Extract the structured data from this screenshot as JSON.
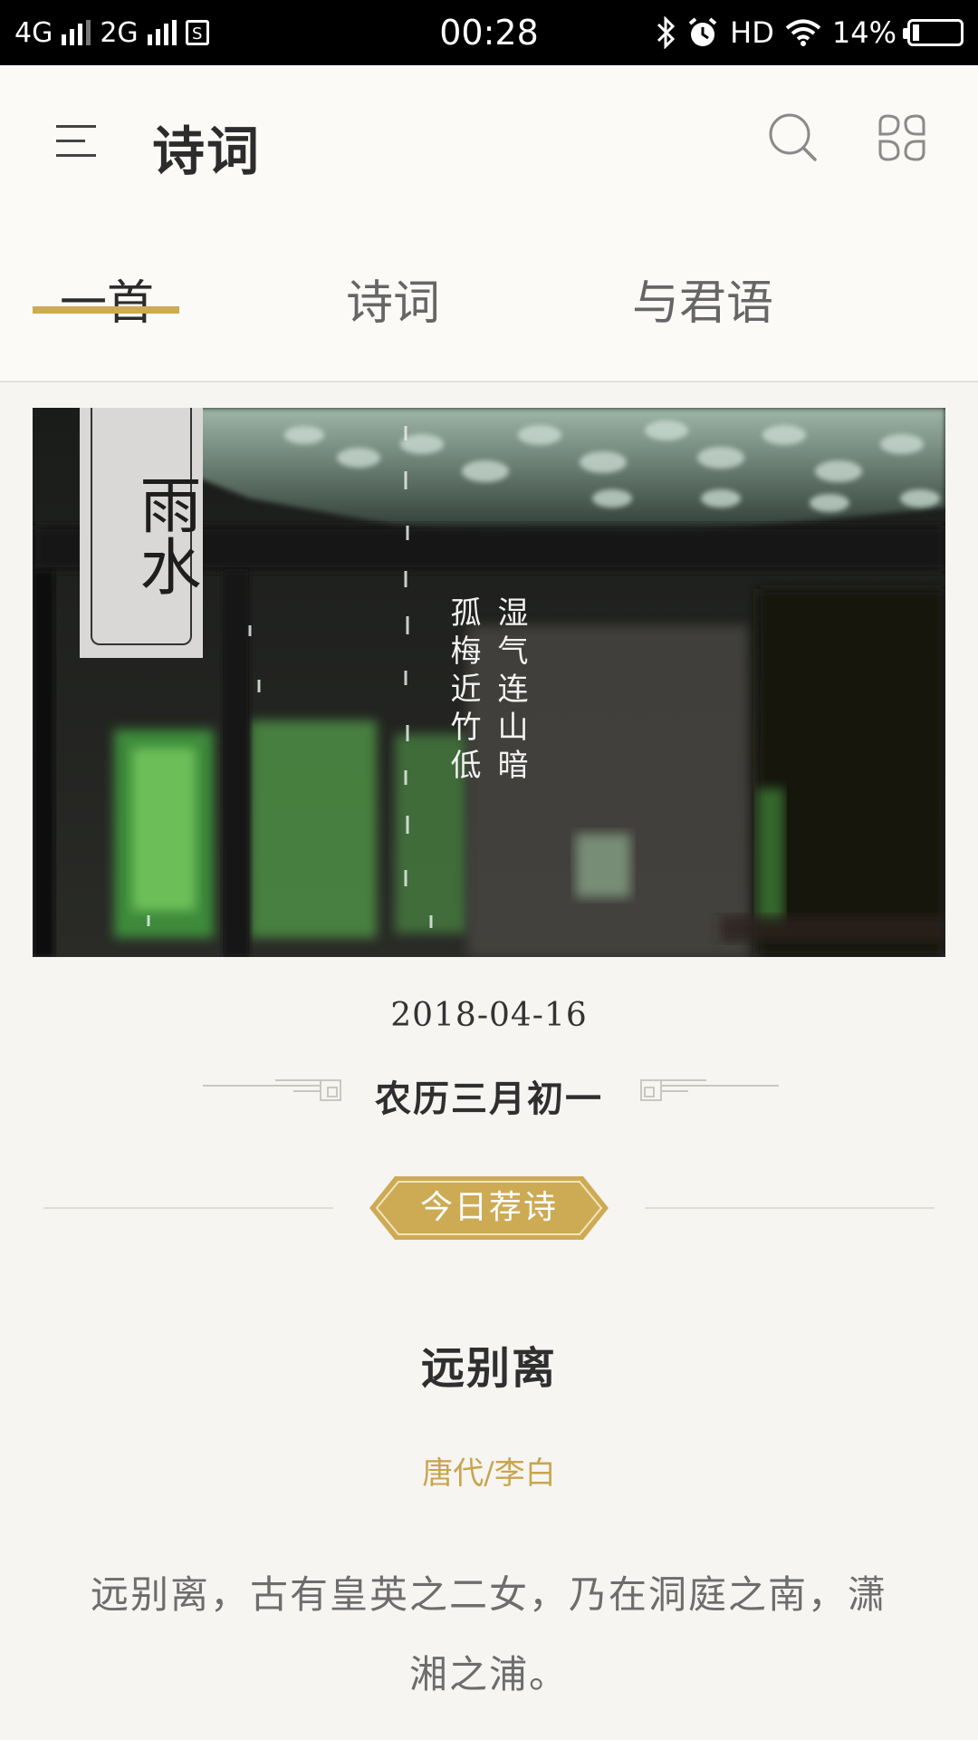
{
  "status_bar": {
    "network_left": "4G",
    "network_right": "2G",
    "time": "00:28",
    "hd": "HD",
    "battery": "14%",
    "battery_level": 0.14
  },
  "header": {
    "title": "诗词",
    "tabs": [
      {
        "label": "一首",
        "active": true
      },
      {
        "label": "诗词",
        "active": false
      },
      {
        "label": "与君语",
        "active": false
      }
    ],
    "accent_color": "#cdaa54"
  },
  "banner": {
    "solar_term": "雨水",
    "poem_lines": [
      "湿气连山暗",
      "孤梅近竹低"
    ]
  },
  "date": {
    "gregorian": "2018-04-16",
    "lunar": "农历三月初一"
  },
  "recommendation": {
    "badge": "今日荐诗"
  },
  "poem": {
    "title": "远别离",
    "author": "唐代/李白",
    "body": "远别离，古有皇英之二女，乃在洞庭之南，潇湘之浦。"
  }
}
